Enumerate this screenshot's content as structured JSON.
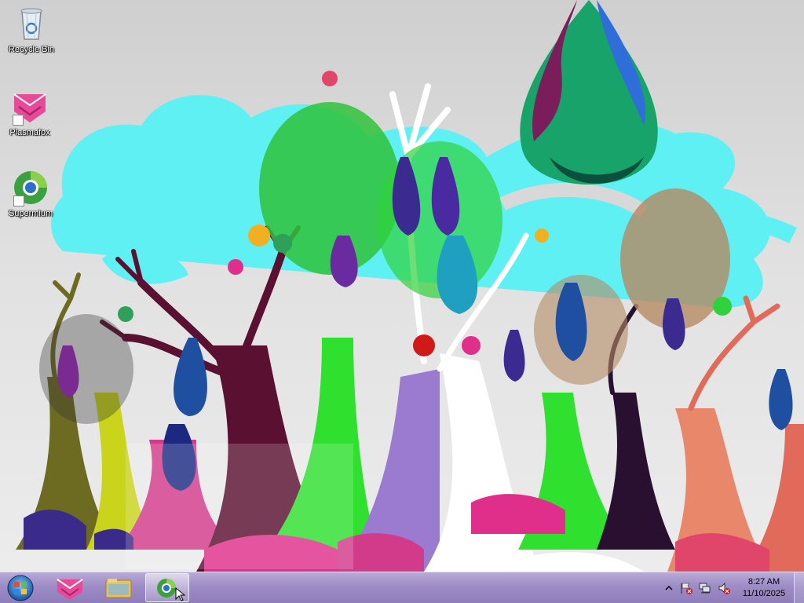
{
  "desktop": {
    "icons": [
      {
        "label": "Recycle Bin",
        "icon": "recycle-bin-icon"
      },
      {
        "label": "Plasmafox",
        "icon": "plasmafox-icon"
      },
      {
        "label": "Supermium",
        "icon": "supermium-icon"
      }
    ]
  },
  "taskbar": {
    "start_icon": "windows-orb-icon",
    "pinned": [
      {
        "icon": "plasmafox-icon"
      },
      {
        "icon": "file-explorer-icon"
      },
      {
        "icon": "supermium-icon",
        "active": true
      }
    ],
    "tray": {
      "icons": [
        "show-hidden-icons-chevron",
        "action-center-flag-icon",
        "network-icon",
        "volume-muted-icon"
      ],
      "time": "8:27 AM",
      "date": "11/10/2025"
    }
  },
  "colors": {
    "taskbar": "#9d8cc6",
    "wallpaper_bg": "#d8d8d8",
    "cloud": "#5ff0f4"
  }
}
